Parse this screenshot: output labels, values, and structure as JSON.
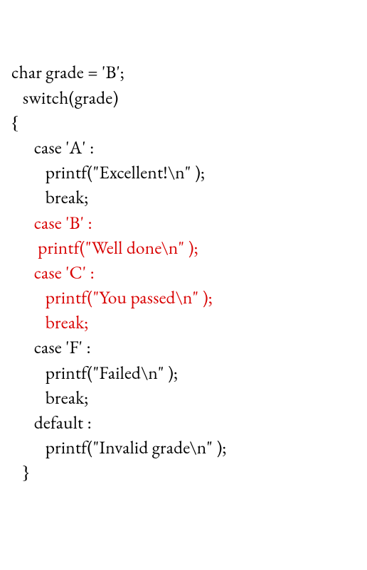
{
  "code": {
    "l1": "char grade = 'B';",
    "l2": "   switch(grade)",
    "l3": "{",
    "l4": "      case 'A' :",
    "l5": "         printf(\"Excellent!\\n\" );",
    "l6": "         break;",
    "l7": "      case 'B' :",
    "l8": "       printf(\"Well done\\n\" );",
    "l9": "      case 'C' :",
    "l10": "         printf(\"You passed\\n\" );",
    "l11": "         break;",
    "l12": "      case 'F' :",
    "l13": "         printf(\"Failed\\n\" );",
    "l14": "         break;",
    "l15": "      default :",
    "l16": "         printf(\"Invalid grade\\n\" );",
    "l17": "   }"
  },
  "highlight_lines": [
    "l7",
    "l8",
    "l9",
    "l10",
    "l11"
  ]
}
